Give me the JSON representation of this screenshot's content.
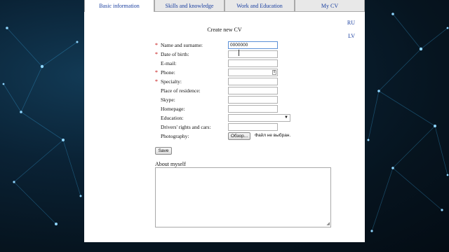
{
  "tabs": [
    {
      "label": "Basic information"
    },
    {
      "label": "Skills and knowledge"
    },
    {
      "label": "Work and Education"
    },
    {
      "label": "My CV"
    }
  ],
  "languages": [
    "RU",
    "LV"
  ],
  "form": {
    "title": "Create new CV",
    "required_mark": "*",
    "fields": [
      {
        "label": "Name and surname:",
        "value": "0000000",
        "required": true
      },
      {
        "label": "Date of birth:",
        "value": "",
        "required": true
      },
      {
        "label": "E-mail:",
        "value": "",
        "required": false
      },
      {
        "label": "Phone:",
        "value": "",
        "required": true
      },
      {
        "label": "Specialty:",
        "value": "",
        "required": true
      },
      {
        "label": "Place of residence:",
        "value": "",
        "required": false
      },
      {
        "label": "Skype:",
        "value": "",
        "required": false
      },
      {
        "label": "Homepage:",
        "value": "",
        "required": false
      },
      {
        "label": "Education:",
        "value": "",
        "required": false
      },
      {
        "label": "Drivers' rights and cars:",
        "value": "",
        "required": false
      },
      {
        "label": "Photography:",
        "value": "",
        "required": false
      }
    ],
    "file_button": "Обзор...",
    "file_status": "Файл не выбран.",
    "save_label": "Save",
    "about_label": "About myself",
    "about_value": ""
  }
}
